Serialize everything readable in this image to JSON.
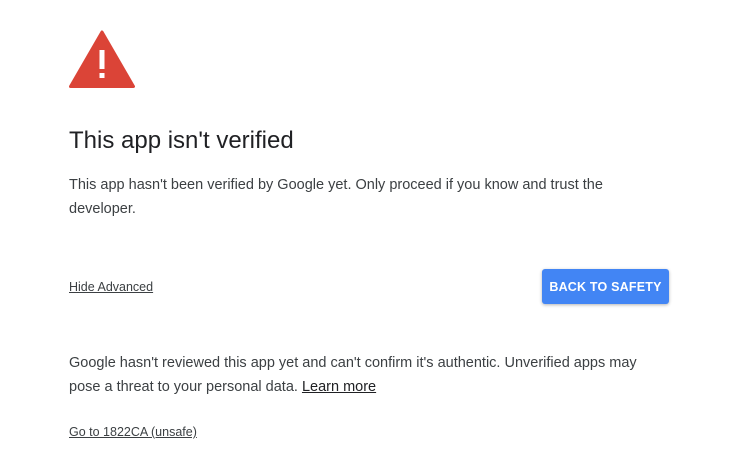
{
  "warning": {
    "icon": "warning-triangle-icon",
    "color": "#db4437"
  },
  "title": "This app isn't verified",
  "description": "This app hasn't been verified by Google yet. Only proceed if you know and trust the developer.",
  "actions": {
    "hide_advanced_label": "Hide Advanced",
    "back_to_safety_label": "BACK TO SAFETY",
    "button_color": "#4285f4"
  },
  "details": {
    "text": "Google hasn't reviewed this app yet and can't confirm it's authentic. Unverified apps may pose a threat to your personal data. ",
    "learn_more_label": "Learn more"
  },
  "proceed": {
    "label": "Go to 1822CA (unsafe)"
  }
}
